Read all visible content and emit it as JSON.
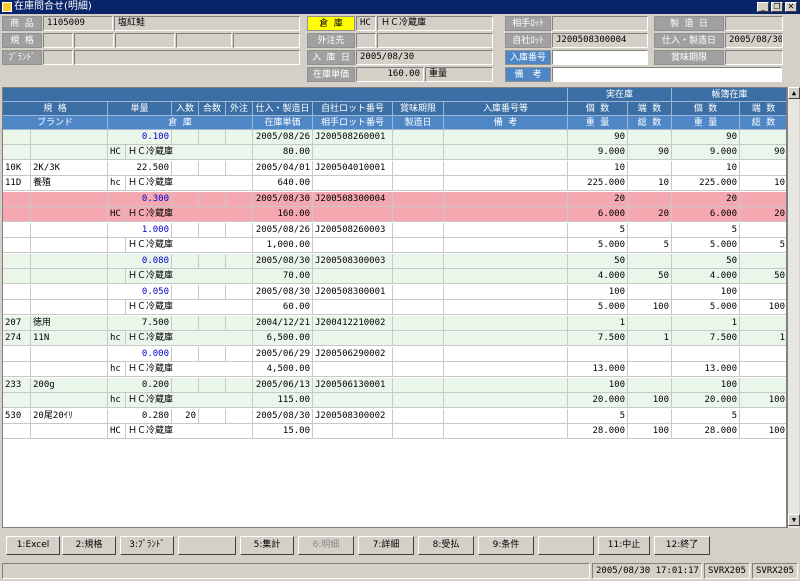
{
  "window": {
    "title": "在庫問合せ(明細)"
  },
  "header": {
    "shohin_label": "商 品",
    "shohin_code": "1105009",
    "shohin_name": "塩紅鮭",
    "kikaku_label": "規 格",
    "brand_label": "ﾌﾞﾗﾝﾄﾞ",
    "souko_label": "倉 庫",
    "souko_code": "HC",
    "souko_name": "ＨＣ冷蔵庫",
    "gaichu_label": "外注先",
    "nyuko_label": "入 庫 日",
    "nyuko_date": "2005/08/30",
    "tanka_label": "在庫単価",
    "tanka_value": "160.00",
    "juryo_label": "重量",
    "aite_lot_label": "相手ﾛｯﾄ",
    "jisha_lot_label": "自社ﾛｯﾄ",
    "jisha_lot_value": "J200508300004",
    "nyuko_no_label": "入庫番号",
    "nyuko_no_value": "",
    "biko_label": "備　考",
    "biko_value": "",
    "seizo_label": "製 造 日",
    "shiire_label": "仕入・製造日",
    "shiire_value": "2005/08/30",
    "shomi_label": "賞味期限"
  },
  "grid": {
    "headers_row1": [
      "規 格",
      "単量",
      "入数",
      "合数",
      "外注",
      "仕入・製造日",
      "自社ロット番号",
      "賞味期限",
      "入庫番号等",
      "個 数",
      "端 数",
      "個 数",
      "端 数"
    ],
    "headers_row2": [
      "ブランド",
      "倉 庫",
      "在庫単価",
      "相手ロット番号",
      "製造日",
      "備 考",
      "重 量",
      "総 数",
      "重 量",
      "総 数"
    ],
    "group_jitsu": "実在庫",
    "group_chobo": "帳簿在庫",
    "rows": [
      {
        "a1": "",
        "a2": "",
        "tanryo": "0.100",
        "irisu": "",
        "gosu": "",
        "gaichu": "",
        "date": "2005/08/26",
        "lot": "J200508260001",
        "kosu": "90",
        "hasu": "",
        "ckosu": "90",
        "chasu": "",
        "b1": "",
        "b2": "",
        "souko_c": "HC",
        "souko": "ＨＣ冷蔵庫",
        "tanka": "80.00",
        "jyuryo": "9.000",
        "sosu": "90",
        "cjyuryo": "9.000",
        "csosu": "90",
        "blue": true,
        "style": "green"
      },
      {
        "a1": "10K",
        "a2": "2K/3K",
        "tanryo": "22.500",
        "irisu": "",
        "gosu": "",
        "gaichu": "",
        "date": "2005/04/01",
        "lot": "J200504010001",
        "kosu": "10",
        "hasu": "",
        "ckosu": "10",
        "chasu": "",
        "b1": "11D",
        "b2": "養殖",
        "souko_c": "hc",
        "souko": "ＨＣ冷蔵庫",
        "tanka": "640.00",
        "jyuryo": "225.000",
        "sosu": "10",
        "cjyuryo": "225.000",
        "csosu": "10",
        "blue": false,
        "style": "white"
      },
      {
        "a1": "",
        "a2": "",
        "tanryo": "0.300",
        "irisu": "",
        "gosu": "",
        "gaichu": "",
        "date": "2005/08/30",
        "lot": "J200508300004",
        "kosu": "20",
        "hasu": "",
        "ckosu": "20",
        "chasu": "",
        "b1": "",
        "b2": "",
        "souko_c": "HC",
        "souko": "ＨＣ冷蔵庫",
        "tanka": "160.00",
        "jyuryo": "6.000",
        "sosu": "20",
        "cjyuryo": "6.000",
        "csosu": "20",
        "blue": true,
        "style": "pink"
      },
      {
        "a1": "",
        "a2": "",
        "tanryo": "1.000",
        "irisu": "",
        "gosu": "",
        "gaichu": "",
        "date": "2005/08/26",
        "lot": "J200508260003",
        "kosu": "5",
        "hasu": "",
        "ckosu": "5",
        "chasu": "",
        "b1": "",
        "b2": "",
        "souko_c": "",
        "souko": "ＨＣ冷蔵庫",
        "tanka": "1,000.00",
        "jyuryo": "5.000",
        "sosu": "5",
        "cjyuryo": "5.000",
        "csosu": "5",
        "blue": true,
        "style": "white"
      },
      {
        "a1": "",
        "a2": "",
        "tanryo": "0.080",
        "irisu": "",
        "gosu": "",
        "gaichu": "",
        "date": "2005/08/30",
        "lot": "J200508300003",
        "kosu": "50",
        "hasu": "",
        "ckosu": "50",
        "chasu": "",
        "b1": "",
        "b2": "",
        "souko_c": "",
        "souko": "ＨＣ冷蔵庫",
        "tanka": "70.00",
        "jyuryo": "4.000",
        "sosu": "50",
        "cjyuryo": "4.000",
        "csosu": "50",
        "blue": true,
        "style": "green"
      },
      {
        "a1": "",
        "a2": "",
        "tanryo": "0.050",
        "irisu": "",
        "gosu": "",
        "gaichu": "",
        "date": "2005/08/30",
        "lot": "J200508300001",
        "kosu": "100",
        "hasu": "",
        "ckosu": "100",
        "chasu": "",
        "b1": "",
        "b2": "",
        "souko_c": "",
        "souko": "ＨＣ冷蔵庫",
        "tanka": "60.00",
        "jyuryo": "5.000",
        "sosu": "100",
        "cjyuryo": "5.000",
        "csosu": "100",
        "blue": true,
        "style": "white"
      },
      {
        "a1": "207",
        "a2": "徳用",
        "tanryo": "7.500",
        "irisu": "",
        "gosu": "",
        "gaichu": "",
        "date": "2004/12/21",
        "lot": "J200412210002",
        "kosu": "1",
        "hasu": "",
        "ckosu": "1",
        "chasu": "",
        "b1": "274",
        "b2": "11N",
        "souko_c": "hc",
        "souko": "ＨＣ冷蔵庫",
        "tanka": "6,500.00",
        "jyuryo": "7.500",
        "sosu": "1",
        "cjyuryo": "7.500",
        "csosu": "1",
        "blue": false,
        "style": "green"
      },
      {
        "a1": "",
        "a2": "",
        "tanryo": "0.000",
        "irisu": "",
        "gosu": "",
        "gaichu": "",
        "date": "2005/06/29",
        "lot": "J200506290002",
        "kosu": "",
        "hasu": "",
        "ckosu": "",
        "chasu": "",
        "b1": "",
        "b2": "",
        "souko_c": "hc",
        "souko": "ＨＣ冷蔵庫",
        "tanka": "4,500.00",
        "jyuryo": "13.000",
        "sosu": "",
        "cjyuryo": "13.000",
        "csosu": "",
        "blue": true,
        "style": "white"
      },
      {
        "a1": "233",
        "a2": "200g",
        "tanryo": "0.200",
        "irisu": "",
        "gosu": "",
        "gaichu": "",
        "date": "2005/06/13",
        "lot": "J200506130001",
        "kosu": "100",
        "hasu": "",
        "ckosu": "100",
        "chasu": "",
        "b1": "",
        "b2": "",
        "souko_c": "hc",
        "souko": "ＨＣ冷蔵庫",
        "tanka": "115.00",
        "jyuryo": "20.000",
        "sosu": "100",
        "cjyuryo": "20.000",
        "csosu": "100",
        "blue": false,
        "style": "green"
      },
      {
        "a1": "530",
        "a2": "20尾20ｲﾘ",
        "tanryo": "0.280",
        "irisu": "20",
        "gosu": "",
        "gaichu": "",
        "date": "2005/08/30",
        "lot": "J200508300002",
        "kosu": "5",
        "hasu": "",
        "ckosu": "5",
        "chasu": "",
        "b1": "",
        "b2": "",
        "souko_c": "HC",
        "souko": "ＨＣ冷蔵庫",
        "tanka": "15.00",
        "jyuryo": "28.000",
        "sosu": "100",
        "cjyuryo": "28.000",
        "csosu": "100",
        "blue": false,
        "style": "white"
      }
    ]
  },
  "fkeys": [
    {
      "label": "1:Excel",
      "disabled": false
    },
    {
      "label": "2:規格",
      "disabled": false
    },
    {
      "label": "3:ﾌﾞﾗﾝﾄﾞ",
      "disabled": false
    },
    {
      "label": "",
      "disabled": false
    },
    {
      "label": "5:集計",
      "disabled": false
    },
    {
      "label": "6:明細",
      "disabled": true
    },
    {
      "label": "7:詳細",
      "disabled": false
    },
    {
      "label": "8:受払",
      "disabled": false
    },
    {
      "label": "9:条件",
      "disabled": false
    },
    {
      "label": "",
      "disabled": false
    },
    {
      "label": "11:中止",
      "disabled": false
    },
    {
      "label": "12:終了",
      "disabled": false
    }
  ],
  "status": {
    "datetime": "2005/08/30 17:01:17",
    "server1": "SVRX205",
    "server2": "SVRX205"
  }
}
